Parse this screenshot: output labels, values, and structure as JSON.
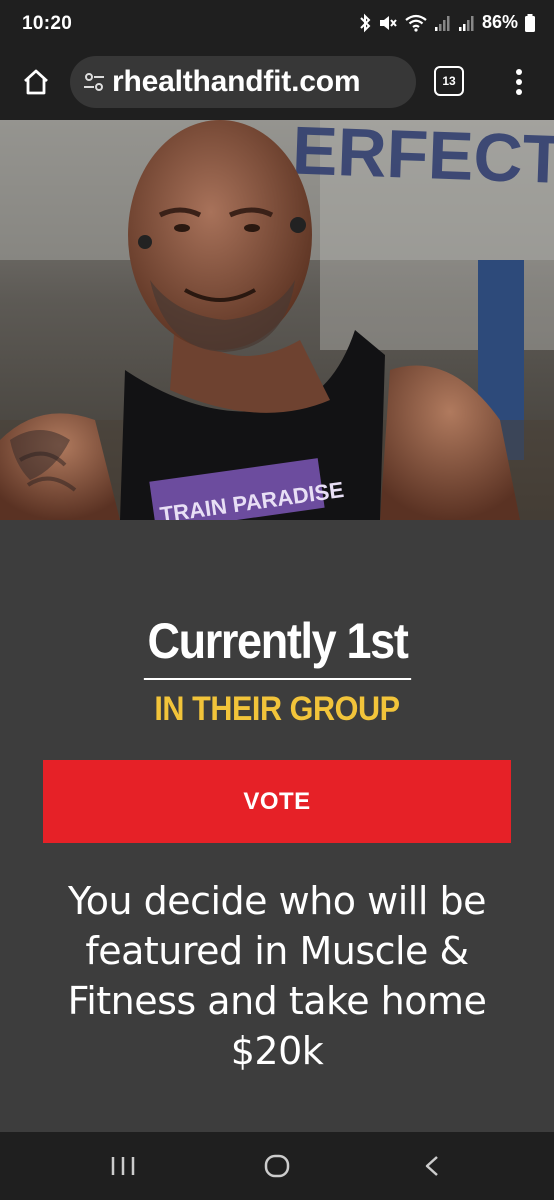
{
  "status_bar": {
    "time": "10:20",
    "battery_percent": "86%",
    "icons": [
      "bluetooth-icon",
      "mute-icon",
      "wifi-icon",
      "signal-icon",
      "signal-icon",
      "battery-icon"
    ]
  },
  "browser": {
    "url": "rhealthandfit.com",
    "tab_count": "13",
    "icons": [
      "home-icon",
      "tune-icon",
      "tabs-icon",
      "more-vert-icon"
    ]
  },
  "hero": {
    "image_semantic": "athlete-photo",
    "banner_text": "ERFECT",
    "shirt_text": "TRAIN PARADISE"
  },
  "ranking": {
    "title": "Currently 1st",
    "subtitle": "IN THEIR GROUP"
  },
  "vote_button": {
    "label": "VOTE"
  },
  "description": "You decide who will be featured in Muscle & Fitness and take home $20k",
  "colors": {
    "background_dark": "#1f1f1f",
    "content_bg": "#3d3d3d",
    "accent_yellow": "#f2c43a",
    "vote_red": "#e62127"
  },
  "nav_bar": {
    "icons": [
      "recents-icon",
      "home-circle-icon",
      "back-icon"
    ]
  }
}
